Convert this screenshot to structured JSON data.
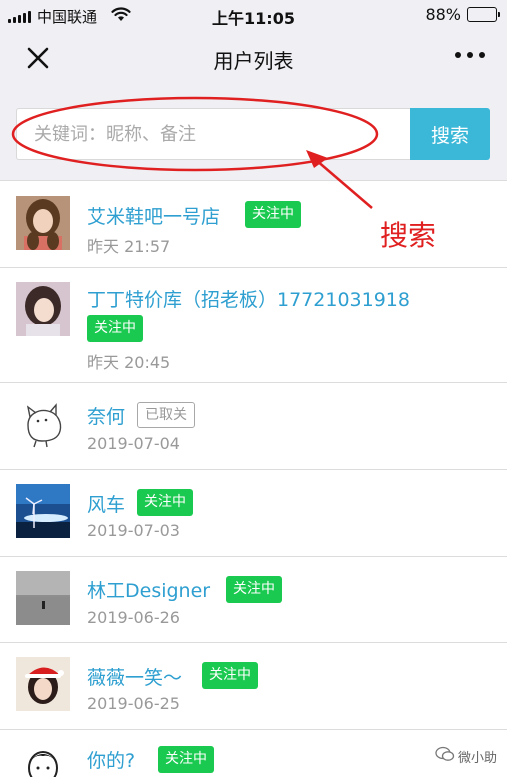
{
  "status_bar": {
    "carrier": "中国联通",
    "time": "上午11:05",
    "battery_text": "88%",
    "battery_level": 0.88
  },
  "nav": {
    "title": "用户列表",
    "close_icon": "close-icon",
    "more_icon": "more-dots-icon"
  },
  "search": {
    "placeholder": "关键词：昵称、备注",
    "value": "",
    "button_label": "搜索",
    "accent_color": "#3bb8d8"
  },
  "annotation": {
    "label": "搜索",
    "color": "#e02020"
  },
  "users": [
    {
      "name": "艾米鞋吧一号店",
      "badge": "关注中",
      "status": "following",
      "time": "昨天 21:57",
      "avatar": "woman-photo"
    },
    {
      "name": "丁丁特价库（招老板）17721031918",
      "badge": "关注中",
      "status": "following",
      "time": "昨天 20:45",
      "avatar": "woman-photo"
    },
    {
      "name": "奈何",
      "badge": "已取关",
      "status": "unfollowed",
      "time": "2019-07-04",
      "avatar": "cat-sketch"
    },
    {
      "name": "风车",
      "badge": "关注中",
      "status": "following",
      "time": "2019-07-03",
      "avatar": "windmill-photo"
    },
    {
      "name": "林工Designer",
      "badge": "关注中",
      "status": "following",
      "time": "2019-06-26",
      "avatar": "landscape-photo"
    },
    {
      "name": "薇薇一笑～",
      "badge": "关注中",
      "status": "following",
      "time": "2019-06-25",
      "avatar": "santa-hat-photo"
    },
    {
      "name": "你的?",
      "badge": "关注中",
      "status": "following",
      "time": "",
      "avatar": "man-sketch"
    }
  ],
  "watermark": {
    "text": "微小助",
    "icon": "wechat-official-icon"
  },
  "colors": {
    "link": "#2e9fd0",
    "follow_badge": "#1ac94f",
    "header_bg": "#efeff4"
  }
}
